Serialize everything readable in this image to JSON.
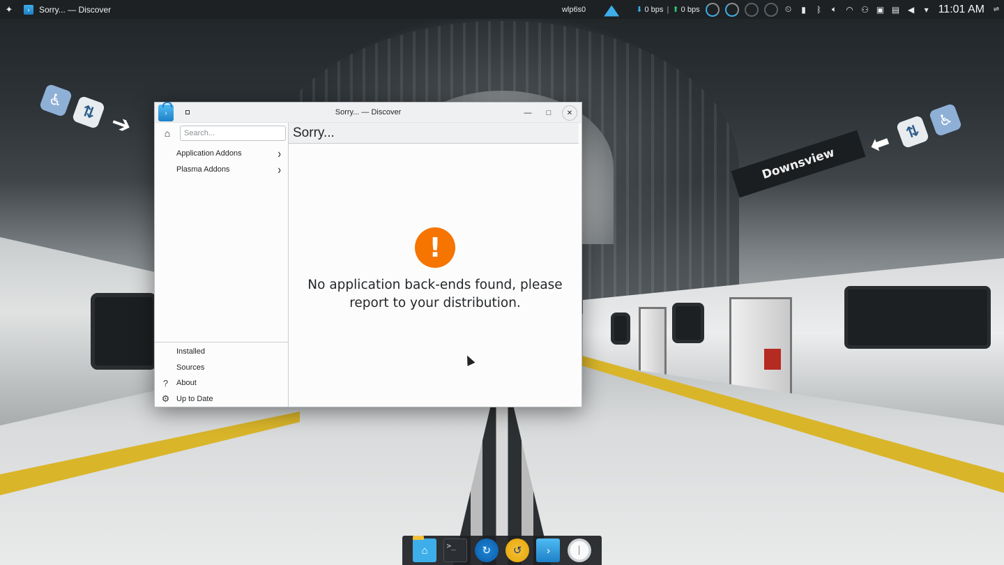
{
  "top_panel": {
    "task_title": "Sorry... — Discover",
    "network_interface": "wlp6s0",
    "download_speed": "0 bps",
    "upload_speed": "0 bps",
    "download_arrow": "⬇",
    "upload_arrow": "⬆",
    "separator": "|",
    "clock": "11:01 AM",
    "tray_icons": [
      "clipboard-icon",
      "battery-icon",
      "bluetooth-icon",
      "volume-icon",
      "wifi-icon",
      "network-icon",
      "display-icon",
      "notes-icon",
      "audio-icon",
      "expand-tray-icon"
    ]
  },
  "wallpaper": {
    "station_sign": "Downsview"
  },
  "window": {
    "title": "Sorry... — Discover",
    "search": {
      "placeholder": "Search...",
      "value": ""
    },
    "categories": [
      {
        "label": "Application Addons"
      },
      {
        "label": "Plasma Addons"
      }
    ],
    "bottom_items": [
      {
        "label": "Installed",
        "icon": "none"
      },
      {
        "label": "Sources",
        "icon": "none"
      },
      {
        "label": "About",
        "icon": "help-icon"
      },
      {
        "label": "Up to Date",
        "icon": "update-gear-icon"
      }
    ],
    "page_title": "Sorry...",
    "error_icon_glyph": "!",
    "error_message": "No application back-ends found, please report to your distribution.",
    "accent_color": "#3daee9",
    "warning_color": "#f67400"
  },
  "dock": {
    "items": [
      "home-folder-icon",
      "terminal-icon",
      "update-icon",
      "backup-icon",
      "discover-icon",
      "clock-icon"
    ],
    "terminal_prompt": ">_"
  }
}
